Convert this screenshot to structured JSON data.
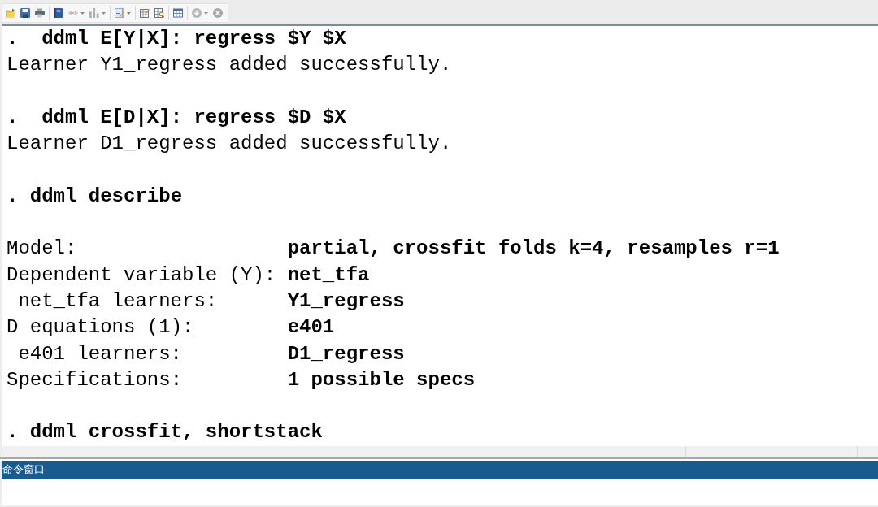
{
  "toolbar": {
    "groups": [
      [
        {
          "disabled": false
        },
        {
          "disabled": false
        },
        {
          "disabled": false
        }
      ],
      [
        {
          "disabled": false
        },
        {
          "disabled": true,
          "menu": true
        },
        {
          "disabled": true,
          "menu": true
        }
      ],
      [
        {
          "disabled": false,
          "menu": true
        }
      ],
      [
        {
          "disabled": false
        },
        {
          "disabled": false
        }
      ],
      [
        {
          "disabled": false
        }
      ],
      [
        {
          "disabled": true,
          "menu": true
        },
        {
          "disabled": true
        }
      ]
    ]
  },
  "results": {
    "lines": [
      {
        "kind": "command",
        "text": ".  ddml E[Y|X]: regress $Y $X"
      },
      {
        "kind": "output",
        "text": "Learner Y1_regress added successfully."
      },
      {
        "kind": "command",
        "text": ".  ddml E[D|X]: regress $D $X"
      },
      {
        "kind": "output",
        "text": "Learner D1_regress added successfully."
      },
      {
        "kind": "command",
        "text": ". ddml describe"
      },
      {
        "kind": "table",
        "rows": [
          {
            "label": "Model:",
            "value": "partial, crossfit folds k=4, resamples r=1"
          },
          {
            "label": "Dependent variable (Y):",
            "value": "net_tfa",
            "children": [
              {
                "label": "net_tfa learners:",
                "value": "Y1_regress"
              }
            ]
          },
          {
            "label": "D equations (1):",
            "value": "e401",
            "children": [
              {
                "label": "e401 learners:",
                "value": "D1_regress"
              }
            ]
          },
          {
            "label": "Specifications:",
            "value": "1 possible specs"
          }
        ]
      },
      {
        "kind": "command",
        "text": ". ddml crossfit, shortstack"
      }
    ]
  },
  "command_window": {
    "title": "命令窗口"
  }
}
